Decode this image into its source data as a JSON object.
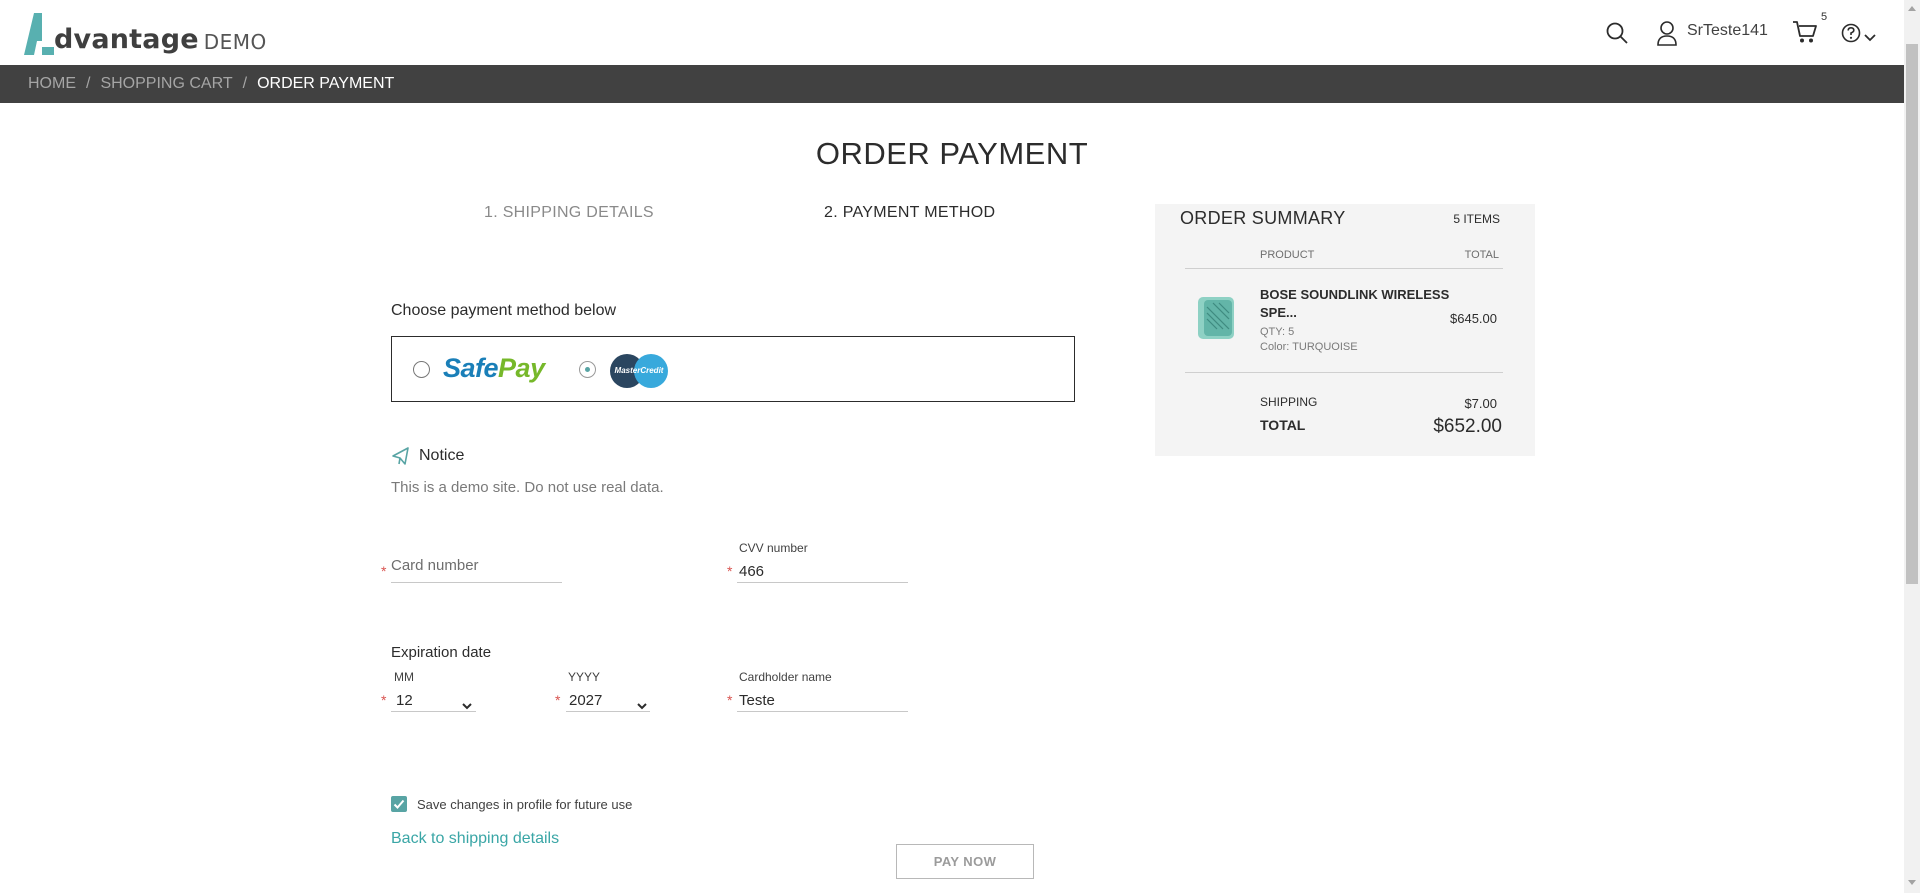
{
  "app": {
    "logo_word": "dvantage",
    "logo_demo": "DEMO"
  },
  "header": {
    "user_name": "SrTeste141",
    "cart_count": "5",
    "icons": [
      "search-icon",
      "user-icon",
      "cart-icon",
      "help-icon",
      "chevron-down-icon"
    ]
  },
  "breadcrumb": {
    "items": [
      "HOME",
      "SHOPPING CART",
      "ORDER PAYMENT"
    ],
    "separator": "/"
  },
  "page": {
    "title": "ORDER PAYMENT",
    "steps": [
      "1. SHIPPING DETAILS",
      "2. PAYMENT METHOD"
    ]
  },
  "payment": {
    "choose_label": "Choose payment method below",
    "methods": [
      {
        "name": "SafePay",
        "part1": "Safe",
        "part2": "Pay",
        "selected": false
      },
      {
        "name": "MasterCredit",
        "selected": true
      }
    ],
    "notice_title": "Notice",
    "notice_text": "This is a demo site. Do not use real data."
  },
  "form": {
    "card_number": {
      "placeholder": "Card number",
      "value": ""
    },
    "cvv": {
      "label": "CVV number",
      "value": "466"
    },
    "expiration_label": "Expiration date",
    "month": {
      "label": "MM",
      "value": "12"
    },
    "year": {
      "label": "YYYY",
      "value": "2027"
    },
    "cardholder": {
      "label": "Cardholder name",
      "value": "Teste"
    },
    "save_checkbox": {
      "label": "Save changes in profile for future use",
      "checked": true
    },
    "back_link": "Back to shipping details",
    "pay_button": "PAY NOW"
  },
  "summary": {
    "title": "ORDER SUMMARY",
    "items_count": "5 ITEMS",
    "col_product": "PRODUCT",
    "col_total": "TOTAL",
    "product": {
      "name": "BOSE SOUNDLINK WIRELESS SPE...",
      "qty": "QTY: 5",
      "color": "Color: TURQUOISE",
      "price": "$645.00"
    },
    "shipping_label": "SHIPPING",
    "shipping_value": "$7.00",
    "total_label": "TOTAL",
    "total_value": "$652.00"
  },
  "colors": {
    "accent": "#58a4a4",
    "breadcrumb_bg": "#414141",
    "link": "#3aa6a6"
  }
}
